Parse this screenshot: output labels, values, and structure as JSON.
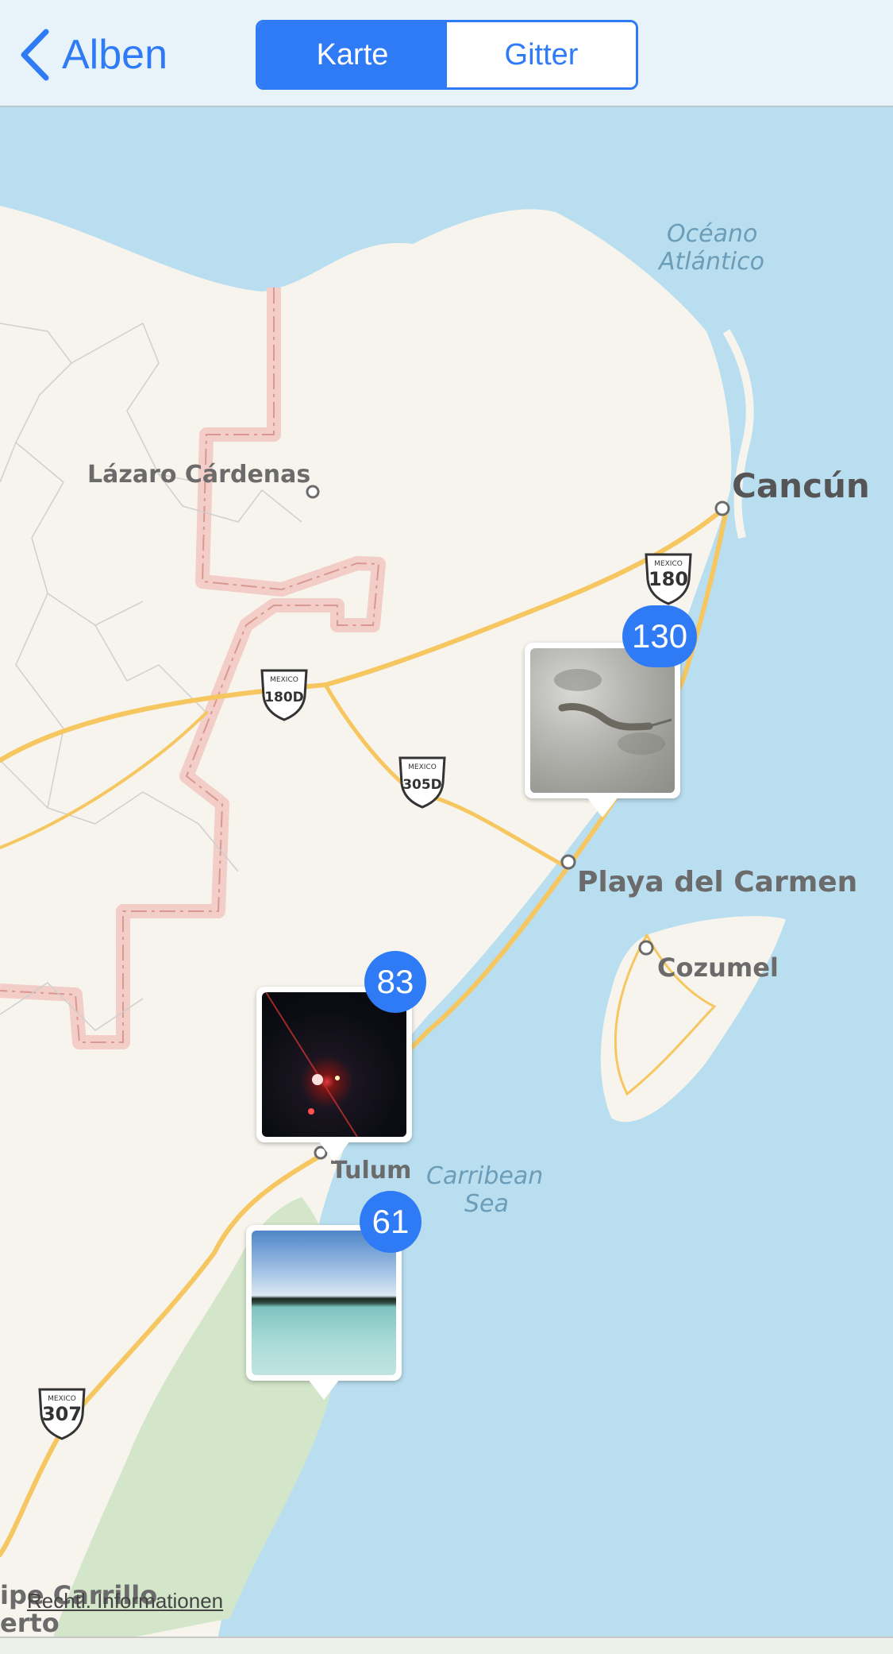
{
  "navbar": {
    "back_label": "Alben",
    "segments": [
      "Karte",
      "Gitter"
    ],
    "active_segment": "Karte"
  },
  "map": {
    "places": {
      "cancun": "Cancún",
      "lazaro": "Lázaro Cárdenas",
      "playa": "Playa del Carmen",
      "cozumel": "Cozumel",
      "tulum": "Tulum",
      "carrillo_1": "ipe Carrillo",
      "carrillo_2": "erto"
    },
    "water": {
      "atlantic_1": "Océano",
      "atlantic_2": "Atlántico",
      "carribean_1": "Carribean",
      "carribean_2": "Sea"
    },
    "shields": {
      "top": "MEXICO",
      "s180": "180",
      "s180d": "180D",
      "s305d": "305D",
      "s307": "307"
    },
    "clusters": [
      {
        "count": "130",
        "photo": "iguana-photo"
      },
      {
        "count": "83",
        "photo": "night-road-photo"
      },
      {
        "count": "61",
        "photo": "lagoon-photo"
      }
    ],
    "legal_link": "Rechtl. Informationen"
  },
  "colors": {
    "accent": "#2f7bf5",
    "water": "#b9def0",
    "land": "#f7f4ed",
    "park": "#d3e6c9",
    "road": "#f6c760",
    "border": "#f3cdc7"
  }
}
